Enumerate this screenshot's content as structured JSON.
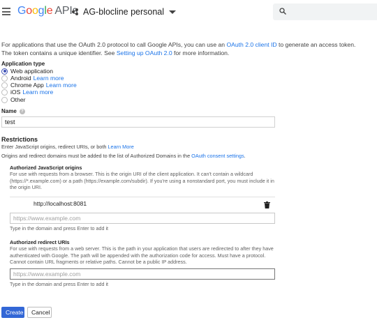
{
  "header": {
    "logo": {
      "G": "G",
      "o1": "o",
      "o2": "o",
      "g": "g",
      "l": "l",
      "e": "e",
      "apis": "APIs"
    },
    "project_name": "AG-blocline personal",
    "search_placeholder": ""
  },
  "intro": {
    "text1": "For applications that use the OAuth 2.0 protocol to call Google APIs, you can use an ",
    "link1": "OAuth 2.0 client ID",
    "text2": " to generate an access token. The token contains a unique identifier. See ",
    "link2": "Setting up OAuth 2.0",
    "text3": " for more information."
  },
  "app_type": {
    "label": "Application type",
    "options": [
      {
        "label": "Web application",
        "link": "",
        "checked": true
      },
      {
        "label": "Android",
        "link": "Learn more",
        "checked": false
      },
      {
        "label": "Chrome App",
        "link": "Learn more",
        "checked": false
      },
      {
        "label": "iOS",
        "link": "Learn more",
        "checked": false
      },
      {
        "label": "Other",
        "link": "",
        "checked": false
      }
    ]
  },
  "name": {
    "label": "Name",
    "value": "test"
  },
  "restrictions": {
    "title": "Restrictions",
    "line1_text": "Enter JavaScript origins, redirect URIs, or both ",
    "line1_link": "Learn More",
    "line2_text": "Origins and redirect domains must be added to the list of Authorized Domains in the ",
    "line2_link": "OAuth consent settings",
    "line2_end": "."
  },
  "js_origins": {
    "title": "Authorized JavaScript origins",
    "description": "For use with requests from a browser. This is the origin URI of the client application. It can't contain a wildcard (https://*.example.com) or a path (https://example.com/subdir). If you're using a nonstandard port, you must include it in the origin URI.",
    "entries": [
      "http://localhost:8081"
    ],
    "placeholder": "https://www.example.com",
    "hint": "Type in the domain and press Enter to add it"
  },
  "redirect_uris": {
    "title": "Authorized redirect URIs",
    "description": "For use with requests from a web server. This is the path in your application that users are redirected to after they have authenticated with Google. The path will be appended with the authorization code for access. Must have a protocol. Cannot contain URL fragments or relative paths. Cannot be a public IP address.",
    "placeholder": "https://www.example.com",
    "hint": "Type in the domain and press Enter to add it"
  },
  "buttons": {
    "create": "Create",
    "cancel": "Cancel"
  },
  "colors": {
    "primary": "#3367d6",
    "link": "#1a73e8",
    "radio": "#3f51b5"
  }
}
